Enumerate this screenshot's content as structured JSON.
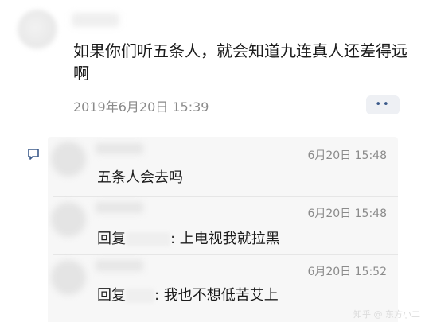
{
  "post": {
    "text": "如果你们听五条人，就会知道九连真人还差得远啊",
    "timestamp": "2019年6月20日 15:39",
    "more_label": "••"
  },
  "comments": [
    {
      "time": "6月20日 15:48",
      "text": "五条人会去吗"
    },
    {
      "time": "6月20日 15:48",
      "reply_prefix": "回复",
      "text": ": 上电视我就拉黑"
    },
    {
      "time": "6月20日 15:52",
      "reply_prefix": "回复",
      "text": ": 我也不想低苦艾上"
    }
  ],
  "watermark": "知乎 @ 东方小二",
  "colors": {
    "accent": "#3b5a8a",
    "muted": "#8a8a8a",
    "panel": "#f7f7f7"
  }
}
